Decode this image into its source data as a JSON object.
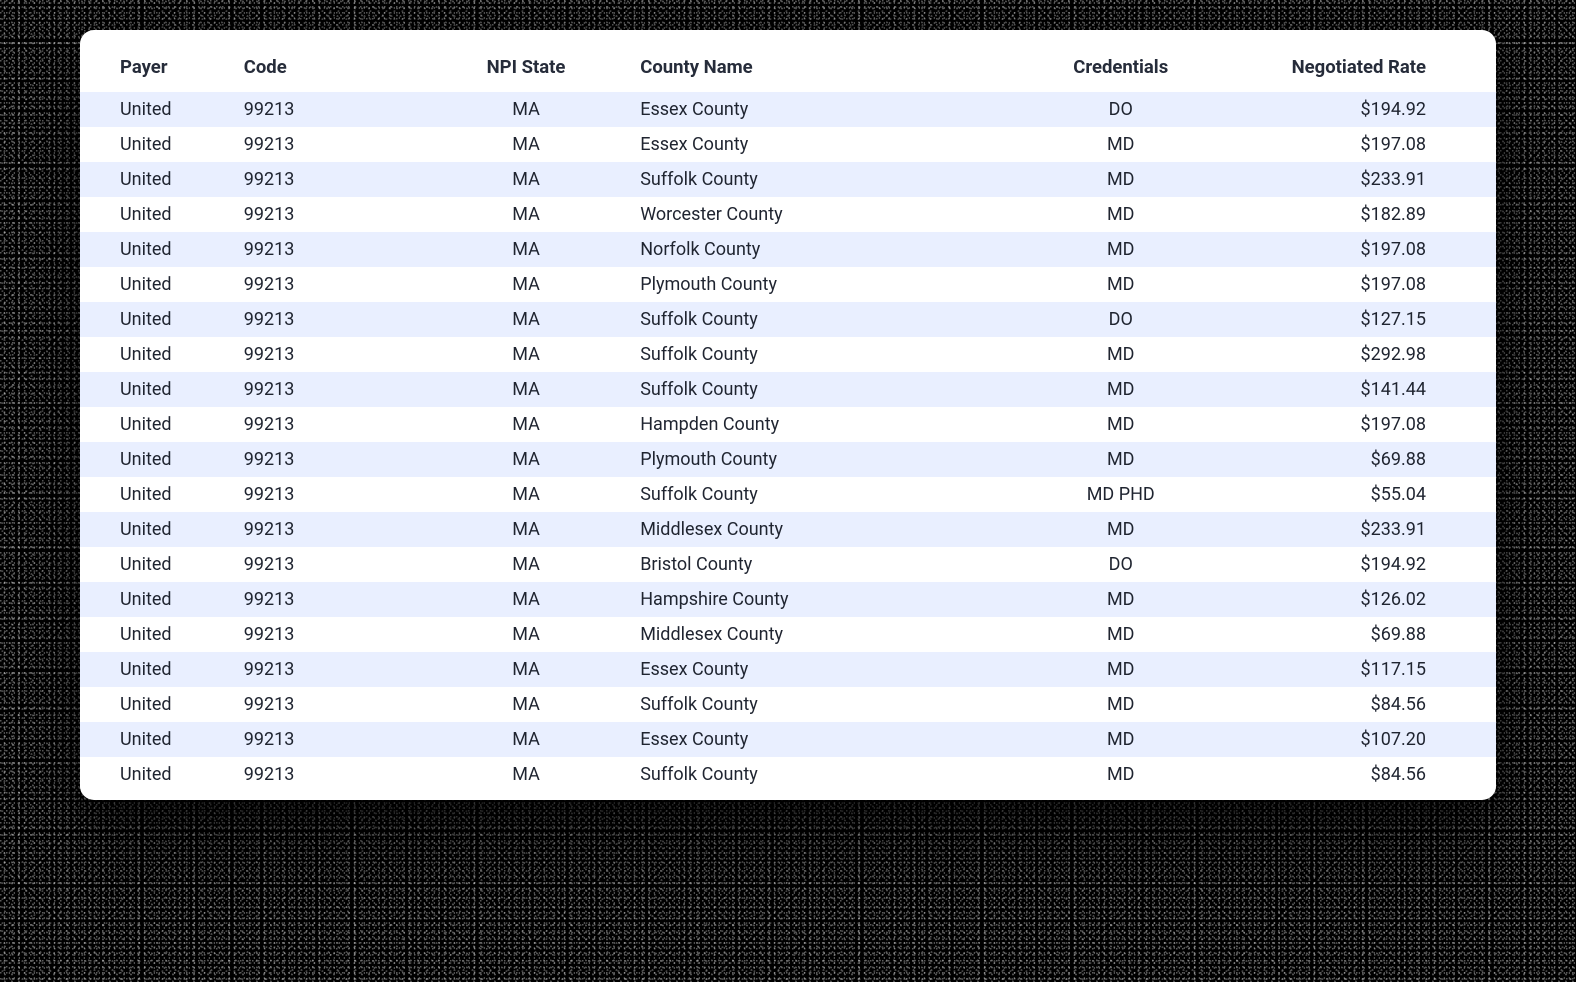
{
  "table": {
    "headers": {
      "payer": "Payer",
      "code": "Code",
      "npi_state": "NPI State",
      "county_name": "County Name",
      "credentials": "Credentials",
      "negotiated_rate": "Negotiated Rate"
    },
    "rows": [
      {
        "payer": "United",
        "code": "99213",
        "npi_state": "MA",
        "county_name": "Essex County",
        "credentials": "DO",
        "negotiated_rate": "$194.92"
      },
      {
        "payer": "United",
        "code": "99213",
        "npi_state": "MA",
        "county_name": "Essex County",
        "credentials": "MD",
        "negotiated_rate": "$197.08"
      },
      {
        "payer": "United",
        "code": "99213",
        "npi_state": "MA",
        "county_name": "Suffolk County",
        "credentials": "MD",
        "negotiated_rate": "$233.91"
      },
      {
        "payer": "United",
        "code": "99213",
        "npi_state": "MA",
        "county_name": "Worcester County",
        "credentials": "MD",
        "negotiated_rate": "$182.89"
      },
      {
        "payer": "United",
        "code": "99213",
        "npi_state": "MA",
        "county_name": "Norfolk County",
        "credentials": "MD",
        "negotiated_rate": "$197.08"
      },
      {
        "payer": "United",
        "code": "99213",
        "npi_state": "MA",
        "county_name": "Plymouth County",
        "credentials": "MD",
        "negotiated_rate": "$197.08"
      },
      {
        "payer": "United",
        "code": "99213",
        "npi_state": "MA",
        "county_name": "Suffolk County",
        "credentials": "DO",
        "negotiated_rate": "$127.15"
      },
      {
        "payer": "United",
        "code": "99213",
        "npi_state": "MA",
        "county_name": "Suffolk County",
        "credentials": "MD",
        "negotiated_rate": "$292.98"
      },
      {
        "payer": "United",
        "code": "99213",
        "npi_state": "MA",
        "county_name": "Suffolk County",
        "credentials": "MD",
        "negotiated_rate": "$141.44"
      },
      {
        "payer": "United",
        "code": "99213",
        "npi_state": "MA",
        "county_name": "Hampden County",
        "credentials": "MD",
        "negotiated_rate": "$197.08"
      },
      {
        "payer": "United",
        "code": "99213",
        "npi_state": "MA",
        "county_name": "Plymouth County",
        "credentials": "MD",
        "negotiated_rate": "$69.88"
      },
      {
        "payer": "United",
        "code": "99213",
        "npi_state": "MA",
        "county_name": "Suffolk County",
        "credentials": "MD PHD",
        "negotiated_rate": "$55.04"
      },
      {
        "payer": "United",
        "code": "99213",
        "npi_state": "MA",
        "county_name": "Middlesex County",
        "credentials": "MD",
        "negotiated_rate": "$233.91"
      },
      {
        "payer": "United",
        "code": "99213",
        "npi_state": "MA",
        "county_name": "Bristol County",
        "credentials": "DO",
        "negotiated_rate": "$194.92"
      },
      {
        "payer": "United",
        "code": "99213",
        "npi_state": "MA",
        "county_name": "Hampshire County",
        "credentials": "MD",
        "negotiated_rate": "$126.02"
      },
      {
        "payer": "United",
        "code": "99213",
        "npi_state": "MA",
        "county_name": "Middlesex County",
        "credentials": "MD",
        "negotiated_rate": "$69.88"
      },
      {
        "payer": "United",
        "code": "99213",
        "npi_state": "MA",
        "county_name": "Essex County",
        "credentials": "MD",
        "negotiated_rate": "$117.15"
      },
      {
        "payer": "United",
        "code": "99213",
        "npi_state": "MA",
        "county_name": "Suffolk County",
        "credentials": "MD",
        "negotiated_rate": "$84.56"
      },
      {
        "payer": "United",
        "code": "99213",
        "npi_state": "MA",
        "county_name": "Essex County",
        "credentials": "MD",
        "negotiated_rate": "$107.20"
      },
      {
        "payer": "United",
        "code": "99213",
        "npi_state": "MA",
        "county_name": "Suffolk County",
        "credentials": "MD",
        "negotiated_rate": "$84.56"
      }
    ]
  }
}
